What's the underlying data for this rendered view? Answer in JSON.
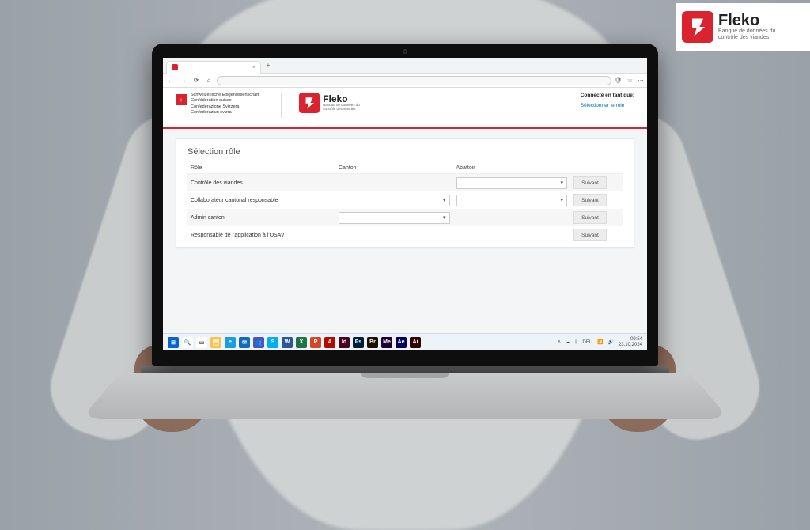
{
  "logo_card": {
    "name": "Fleko",
    "subtitle_line1": "Banque de données du",
    "subtitle_line2": "contrôle des viandes"
  },
  "browser": {
    "tab_close": "×",
    "back": "←",
    "forward": "→",
    "reload": "⟳",
    "home": "⌂",
    "shield": "🛡",
    "star": "☆",
    "menu": "⋯"
  },
  "page_header": {
    "gov_line1": "Schweizerische Eidgenossenschaft",
    "gov_line2": "Confédération suisse",
    "gov_line3": "Confederazione Svizzera",
    "gov_line4": "Confederaziun svizra",
    "fleko_name": "Fleko",
    "fleko_sub1": "Banque de données du",
    "fleko_sub2": "contrôle des viandes",
    "auth_label": "Connecté en tant que:",
    "auth_link": "Sélectionner le rôle"
  },
  "content": {
    "title": "Sélection rôle",
    "columns": {
      "role": "Rôle",
      "canton": "Canton",
      "abattoir": "Abattoir"
    },
    "rows": [
      {
        "role": "Contrôle des viandes",
        "canton_select": false,
        "abattoir_select": true,
        "btn": "Suivant"
      },
      {
        "role": "Collaborateur cantonal responsable",
        "canton_select": true,
        "abattoir_select": true,
        "btn": "Suivant"
      },
      {
        "role": "Admin canton",
        "canton_select": true,
        "abattoir_select": false,
        "btn": "Suivant"
      },
      {
        "role": "Responsable de l'application à l'OSAV",
        "canton_select": false,
        "abattoir_select": false,
        "btn": "Suivant"
      }
    ],
    "dropdown_caret": "▾"
  },
  "taskbar": {
    "icons": [
      {
        "name": "start",
        "bg": "#0a63c9",
        "txt": "⊞"
      },
      {
        "name": "search",
        "bg": "#fff",
        "txt": "🔍"
      },
      {
        "name": "taskview",
        "bg": "#fff",
        "txt": "▭"
      },
      {
        "name": "explorer",
        "bg": "#f6c446",
        "txt": "🗂"
      },
      {
        "name": "edge",
        "bg": "#1b9de2",
        "txt": "e"
      },
      {
        "name": "outlook",
        "bg": "#0f6cbd",
        "txt": "✉"
      },
      {
        "name": "teams",
        "bg": "#4b53bc",
        "txt": "👥"
      },
      {
        "name": "skype",
        "bg": "#00aff0",
        "txt": "S"
      },
      {
        "name": "word",
        "bg": "#2b579a",
        "txt": "W"
      },
      {
        "name": "excel",
        "bg": "#217346",
        "txt": "X"
      },
      {
        "name": "powerpoint",
        "bg": "#d24726",
        "txt": "P"
      },
      {
        "name": "acrobat",
        "bg": "#b30b00",
        "txt": "A"
      },
      {
        "name": "indesign",
        "bg": "#49021f",
        "txt": "Id"
      },
      {
        "name": "photoshop",
        "bg": "#001e36",
        "txt": "Ps"
      },
      {
        "name": "bridge",
        "bg": "#1a1100",
        "txt": "Br"
      },
      {
        "name": "media-encoder",
        "bg": "#1a0033",
        "txt": "Me"
      },
      {
        "name": "after-effects",
        "bg": "#00005b",
        "txt": "Ae"
      },
      {
        "name": "illustrator",
        "bg": "#330000",
        "txt": "Ai"
      }
    ],
    "tray": {
      "chevron": "˄",
      "cloud": "☁",
      "bt": "ᛒ",
      "lang": "DEU",
      "net": "📶",
      "vol": "🔊",
      "time": "09:54",
      "date": "23.10.2024"
    }
  }
}
